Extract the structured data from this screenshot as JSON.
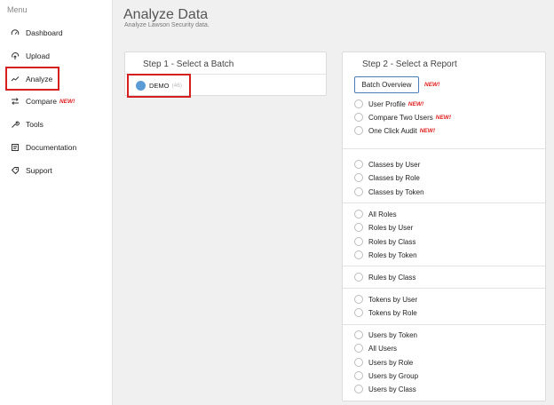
{
  "sidebar": {
    "menu_label": "Menu",
    "items": [
      {
        "label": "Dashboard",
        "icon": "dashboard-icon"
      },
      {
        "label": "Upload",
        "icon": "upload-icon"
      },
      {
        "label": "Analyze",
        "icon": "analyze-icon"
      },
      {
        "label": "Compare",
        "icon": "compare-icon",
        "badge": "NEW!"
      },
      {
        "label": "Tools",
        "icon": "tools-icon"
      },
      {
        "label": "Documentation",
        "icon": "documentation-icon"
      },
      {
        "label": "Support",
        "icon": "support-icon"
      }
    ]
  },
  "header": {
    "title": "Analyze Data",
    "subtitle": "Analyze Lawson Security data."
  },
  "step1": {
    "title": "Step 1 - Select a Batch",
    "batch": {
      "name": "DEMO",
      "count": "(46)"
    }
  },
  "step2": {
    "title": "Step 2 - Select a Report",
    "batch_overview_label": "Batch Overview",
    "new_badge": "NEW!",
    "groups": [
      [
        {
          "label": "User Profile",
          "badge": "NEW!"
        },
        {
          "label": "Compare Two Users",
          "badge": "NEW!"
        },
        {
          "label": "One Click Audit",
          "badge": "NEW!"
        }
      ],
      [
        {
          "label": "Classes by User"
        },
        {
          "label": "Classes by Role"
        },
        {
          "label": "Classes by Token"
        }
      ],
      [
        {
          "label": "All Roles"
        },
        {
          "label": "Roles by User"
        },
        {
          "label": "Roles by Class"
        },
        {
          "label": "Roles by Token"
        }
      ],
      [
        {
          "label": "Rules by Class"
        }
      ],
      [
        {
          "label": "Tokens by User"
        },
        {
          "label": "Tokens by Role"
        }
      ],
      [
        {
          "label": "Users by Token"
        },
        {
          "label": "All Users"
        },
        {
          "label": "Users by Role"
        },
        {
          "label": "Users by Group"
        },
        {
          "label": "Users by Class"
        }
      ]
    ]
  },
  "colors": {
    "highlight": "#d62020",
    "batch_dot": "#5b9bd5",
    "new_badge": "#e02020",
    "button_border": "#4a7db5"
  }
}
